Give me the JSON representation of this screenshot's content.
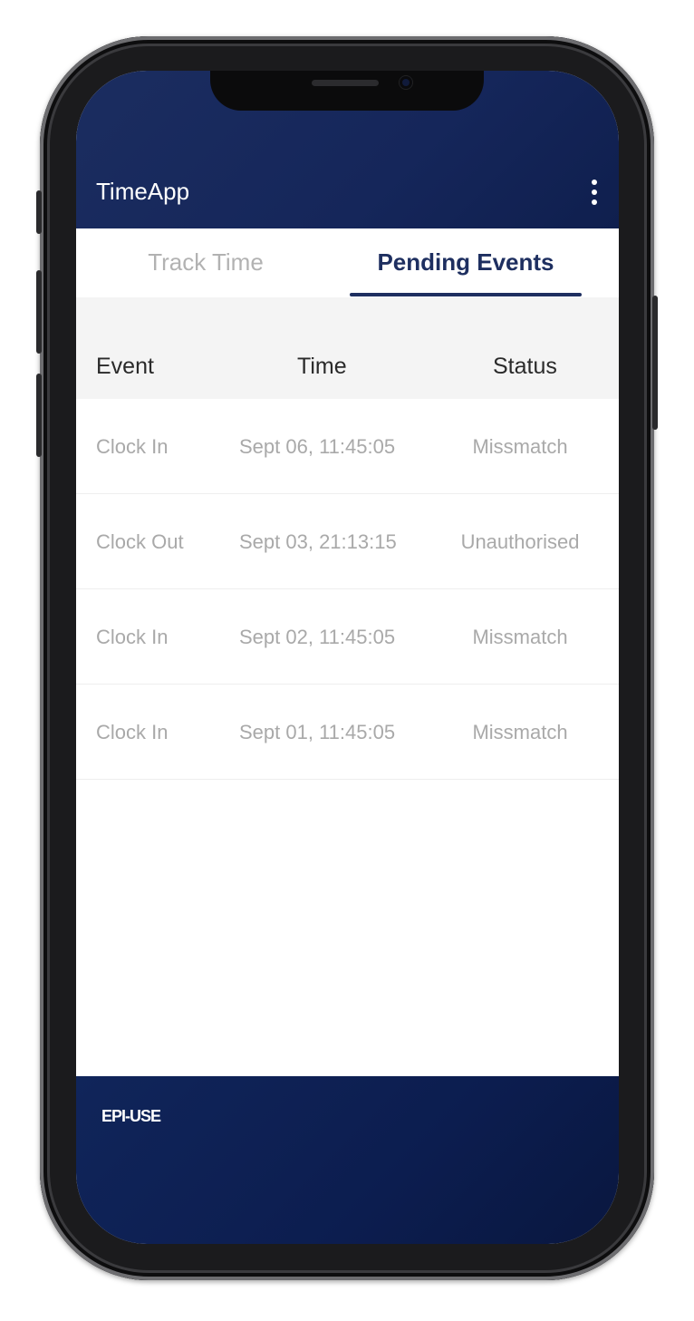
{
  "app": {
    "title": "TimeApp"
  },
  "tabs": [
    {
      "label": "Track Time",
      "active": false
    },
    {
      "label": "Pending Events",
      "active": true
    }
  ],
  "table": {
    "columns": [
      "Event",
      "Time",
      "Status"
    ],
    "rows": [
      {
        "event": "Clock In",
        "time": "Sept 06, 11:45:05",
        "status": "Missmatch"
      },
      {
        "event": "Clock Out",
        "time": "Sept 03, 21:13:15",
        "status": "Unauthorised"
      },
      {
        "event": "Clock In",
        "time": "Sept 02, 11:45:05",
        "status": "Missmatch"
      },
      {
        "event": "Clock In",
        "time": "Sept 01, 11:45:05",
        "status": "Missmatch"
      }
    ]
  },
  "footer": {
    "logo_text": "EPI-USE"
  },
  "icons": {
    "menu": "more-vertical-icon"
  },
  "colors": {
    "primary": "#1b2d60",
    "active_tab": "#1e2f60",
    "inactive_tab": "#b2b2b2"
  }
}
